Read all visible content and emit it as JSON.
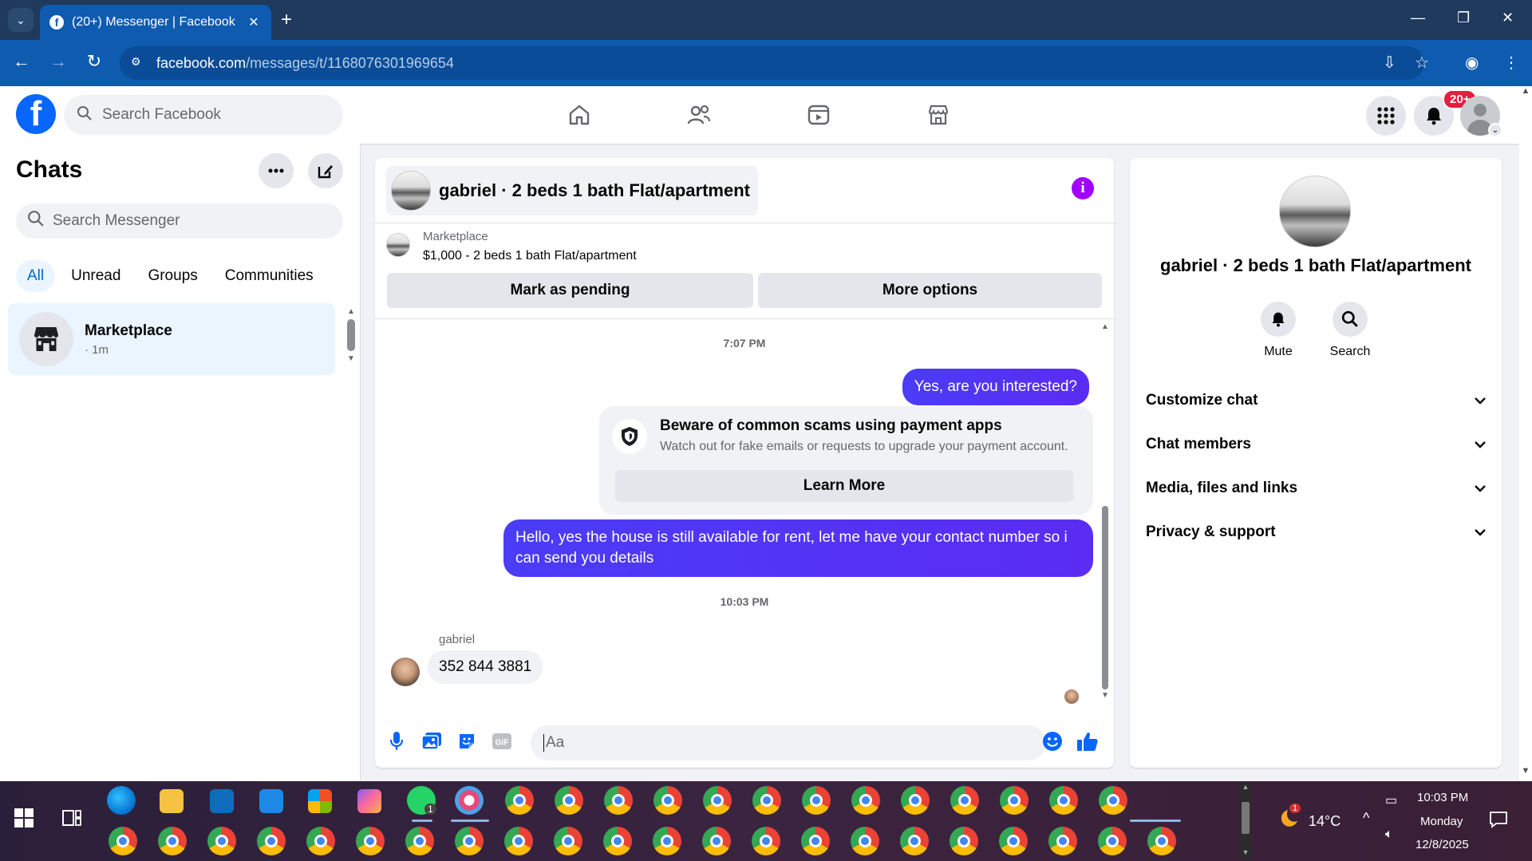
{
  "browser": {
    "tab_title": "(20+) Messenger | Facebook",
    "url_host": "facebook.com",
    "url_path": "/messages/t/1168076301969654"
  },
  "fb_header": {
    "search_placeholder": "Search Facebook",
    "notification_badge": "20+",
    "nav_icons": [
      "home-icon",
      "friends-icon",
      "video-icon",
      "marketplace-icon"
    ]
  },
  "chats": {
    "title": "Chats",
    "search_placeholder": "Search Messenger",
    "filters": [
      "All",
      "Unread",
      "Groups",
      "Communities"
    ],
    "active_filter": "All",
    "items": [
      {
        "name": "Marketplace",
        "time": "· 1m"
      }
    ]
  },
  "conversation": {
    "title": "gabriel · 2 beds 1 bath Flat/apartment",
    "marketplace_label": "Marketplace",
    "listing": "$1,000 - 2 beds 1 bath Flat/apartment",
    "mark_pending_label": "Mark as pending",
    "more_options_label": "More options",
    "timestamp_1": "7:07 PM",
    "msg_out_1": "Yes, are you interested?",
    "warning": {
      "title": "Beware of common scams using payment apps",
      "subtitle": "Watch out for fake emails or requests to upgrade your payment account.",
      "button": "Learn More"
    },
    "msg_out_2": "Hello, yes the house is still available for rent, let me have your contact number so i can send you details",
    "timestamp_2": "10:03 PM",
    "sender_name": "gabriel",
    "msg_in_1": "352 844 3881",
    "composer_placeholder": "Aa"
  },
  "right_panel": {
    "name": "gabriel · 2 beds 1 bath Flat/apartment",
    "actions": [
      {
        "label": "Mute",
        "icon": "bell-icon"
      },
      {
        "label": "Search",
        "icon": "search-icon"
      }
    ],
    "sections": [
      "Customize chat",
      "Chat members",
      "Media, files and links",
      "Privacy & support"
    ]
  },
  "taskbar": {
    "weather_temp": "14°C",
    "weather_badge": "1",
    "whatsapp_badge": "1",
    "time": "10:03 PM",
    "day": "Monday",
    "date": "12/8/2025"
  },
  "colors": {
    "fb_blue": "#0866ff",
    "bubble_purple": "#5b2cf2",
    "info_purple": "#a100ff",
    "browser_blue": "#0e5bb0"
  }
}
